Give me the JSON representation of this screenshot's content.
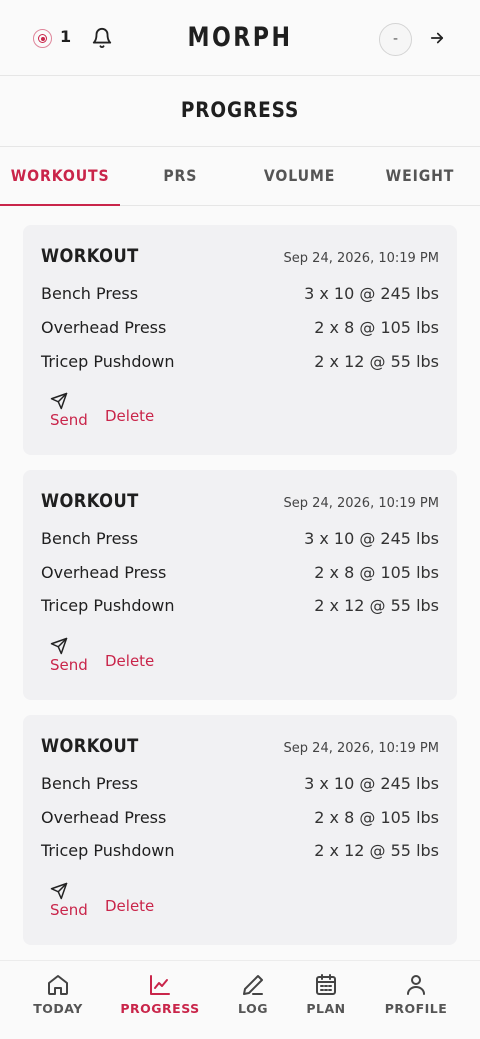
{
  "header": {
    "brand": "MORPH",
    "notification_count": "1",
    "avatar_initial": "-"
  },
  "page": {
    "title": "PROGRESS"
  },
  "tabs": [
    {
      "label": "WORKOUTS",
      "active": true
    },
    {
      "label": "PRS",
      "active": false
    },
    {
      "label": "VOLUME",
      "active": false
    },
    {
      "label": "WEIGHT",
      "active": false
    }
  ],
  "workouts": [
    {
      "title": "WORKOUT",
      "date": "Sep 24, 2026, 10:19 PM",
      "exercises": [
        {
          "name": "Bench Press",
          "sets": "3 x 10 @ 245 lbs"
        },
        {
          "name": "Overhead Press",
          "sets": "2 x 8 @ 105 lbs"
        },
        {
          "name": "Tricep Pushdown",
          "sets": "2 x 12 @ 55 lbs"
        }
      ],
      "send_label": "Send",
      "delete_label": "Delete"
    },
    {
      "title": "WORKOUT",
      "date": "Sep 24, 2026, 10:19 PM",
      "exercises": [
        {
          "name": "Bench Press",
          "sets": "3 x 10 @ 245 lbs"
        },
        {
          "name": "Overhead Press",
          "sets": "2 x 8 @ 105 lbs"
        },
        {
          "name": "Tricep Pushdown",
          "sets": "2 x 12 @ 55 lbs"
        }
      ],
      "send_label": "Send",
      "delete_label": "Delete"
    },
    {
      "title": "WORKOUT",
      "date": "Sep 24, 2026, 10:19 PM",
      "exercises": [
        {
          "name": "Bench Press",
          "sets": "3 x 10 @ 245 lbs"
        },
        {
          "name": "Overhead Press",
          "sets": "2 x 8 @ 105 lbs"
        },
        {
          "name": "Tricep Pushdown",
          "sets": "2 x 12 @ 55 lbs"
        }
      ],
      "send_label": "Send",
      "delete_label": "Delete"
    }
  ],
  "bottom_nav": [
    {
      "label": "TODAY",
      "icon": "home-icon",
      "active": false
    },
    {
      "label": "PROGRESS",
      "icon": "chart-line-icon",
      "active": true
    },
    {
      "label": "LOG",
      "icon": "pencil-icon",
      "active": false
    },
    {
      "label": "PLAN",
      "icon": "calendar-icon",
      "active": false
    },
    {
      "label": "PROFILE",
      "icon": "user-icon",
      "active": false
    }
  ],
  "colors": {
    "accent": "#c9254a",
    "background": "#fafafa",
    "card": "#f1f1f3",
    "text": "#1f1f1f"
  }
}
